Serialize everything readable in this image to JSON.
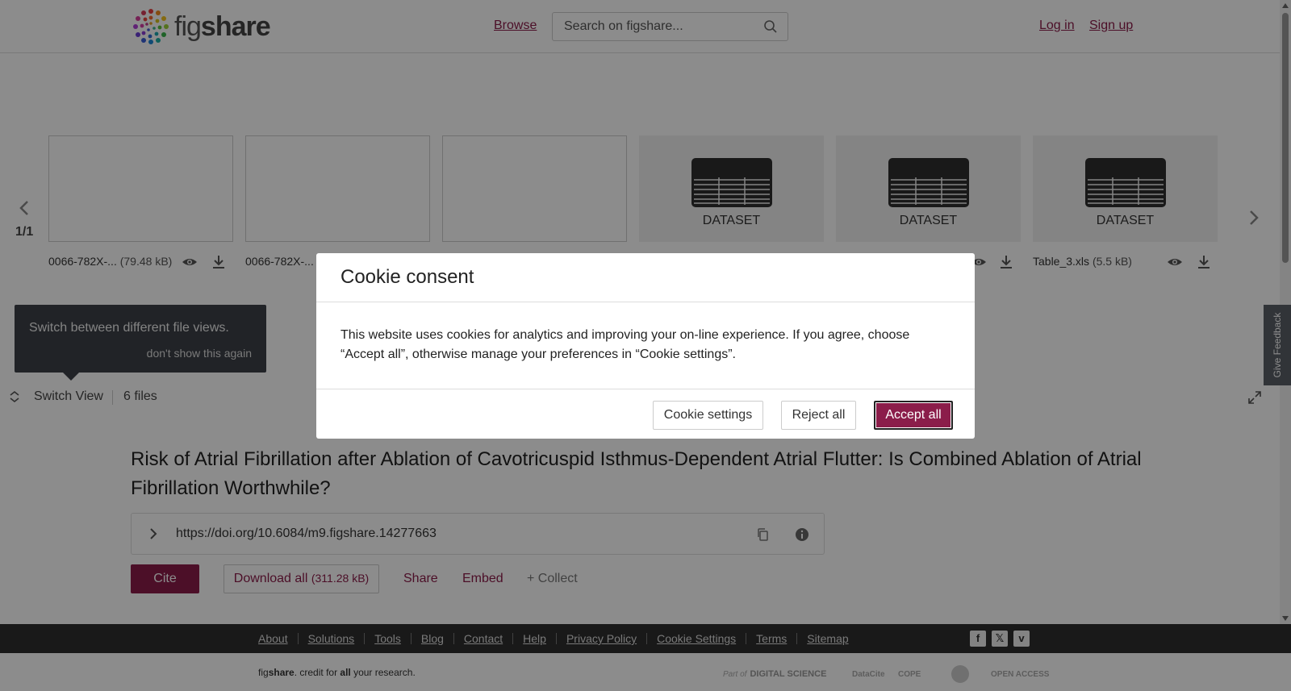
{
  "header": {
    "logo_text_light": "fig",
    "logo_text_bold": "share",
    "browse_label": "Browse",
    "search_placeholder": "Search on figshare...",
    "login_label": "Log in",
    "signup_label": "Sign up"
  },
  "carousel": {
    "page_indicator": "1/1",
    "files": [
      {
        "name": "0066-782X-...",
        "size": "(79.48 kB)",
        "type": "image"
      },
      {
        "name": "0066-782X-...",
        "size": "",
        "type": "image"
      },
      {
        "name": "",
        "size": "",
        "type": "image"
      },
      {
        "name": "",
        "size": "",
        "type": "dataset",
        "badge": "DATASET"
      },
      {
        "name": "",
        "size": "",
        "type": "dataset",
        "badge": "DATASET"
      },
      {
        "name": "Table_3.xls",
        "size": "(5.5 kB)",
        "type": "dataset",
        "badge": "DATASET"
      }
    ]
  },
  "tooltip": {
    "text": "Switch between different file views.",
    "dismiss_label": "don't show this again"
  },
  "view_bar": {
    "switch_label": "Switch View",
    "file_count": "6 files"
  },
  "article": {
    "title": "Risk of Atrial Fibrillation after Ablation of Cavotricuspid Isthmus-Dependent Atrial Flutter: Is Combined Ablation of Atrial Fibrillation Worthwhile?",
    "doi": "https://doi.org/10.6084/m9.figshare.14277663",
    "cite_label": "Cite",
    "download_label": "Download all",
    "download_size": "(311.28 kB)",
    "share_label": "Share",
    "embed_label": "Embed",
    "collect_label": "+ Collect"
  },
  "feedback_label": "Give Feedback",
  "footer": {
    "links": [
      "About",
      "Solutions",
      "Tools",
      "Blog",
      "Contact",
      "Help",
      "Privacy Policy",
      "Cookie Settings",
      "Terms",
      "Sitemap"
    ],
    "tagline_pre": "fig",
    "tagline_bold": "share",
    "tagline_mid": ". credit for ",
    "tagline_all": "all",
    "tagline_post": " your research.",
    "part_of": "Part of",
    "digital_science": "DIGITAL SCIENCE",
    "partners": [
      "DataCite",
      "COPE",
      "OPEN ACCESS"
    ]
  },
  "cookie_modal": {
    "title": "Cookie consent",
    "body": "This website uses cookies for analytics and improving your on-line experience. If you agree, choose “Accept all”, otherwise manage your preferences in “Cookie settings”.",
    "settings_label": "Cookie settings",
    "reject_label": "Reject all",
    "accept_label": "Accept all"
  },
  "colors": {
    "brand": "#8b1d4a",
    "overlay": "rgba(0,0,0,0.45)",
    "footer_bg": "#2f2f2f"
  },
  "icons": [
    "search-icon",
    "chevron-left-icon",
    "chevron-right-icon",
    "eye-icon",
    "download-icon",
    "table-icon",
    "switch-view-icon",
    "expand-icon",
    "chevron-right-icon",
    "copy-icon",
    "info-icon",
    "facebook-icon",
    "x-icon",
    "vimeo-icon"
  ]
}
